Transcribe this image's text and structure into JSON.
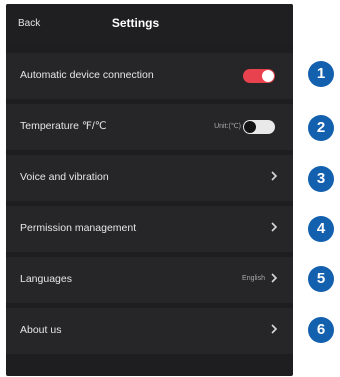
{
  "header": {
    "back_label": "Back",
    "title": "Settings"
  },
  "rows": [
    {
      "label": "Automatic device connection",
      "control": "toggle",
      "on": true
    },
    {
      "label": "Temperature ℉/℃",
      "value": "Unit:(℃)",
      "control": "toggle",
      "on": false
    },
    {
      "label": "Voice and vibration",
      "control": "chevron"
    },
    {
      "label": "Permission management",
      "control": "chevron"
    },
    {
      "label": "Languages",
      "value": "English",
      "control": "chevron"
    },
    {
      "label": "About us",
      "control": "chevron"
    }
  ],
  "badges": [
    "1",
    "2",
    "3",
    "4",
    "5",
    "6"
  ],
  "colors": {
    "background": "#1e1e20",
    "row": "#262628",
    "toggle_on": "#e8424e",
    "badge": "#1260ae"
  },
  "icons": {
    "chevron": "chevron-right-icon"
  }
}
